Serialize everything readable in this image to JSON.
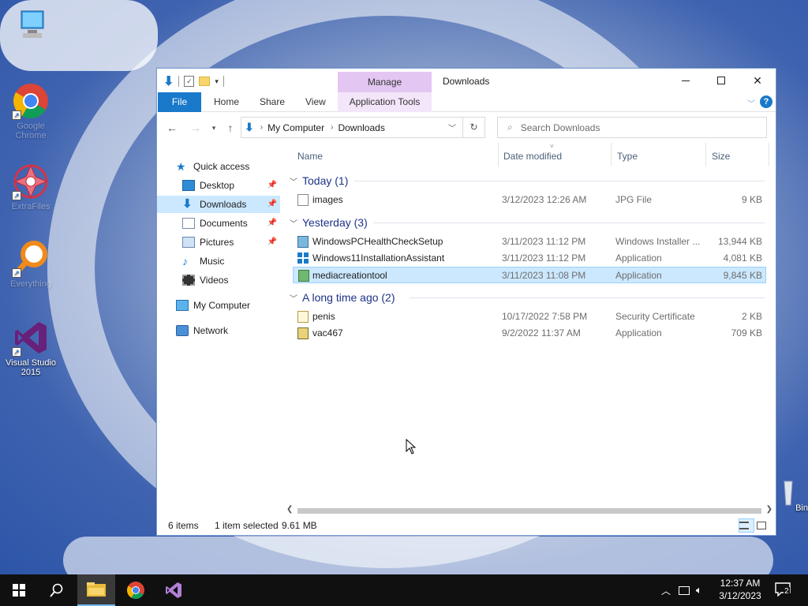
{
  "desktop": {
    "icons": [
      {
        "label": "",
        "icon": "computer-icon"
      },
      {
        "label": "Google Chrome",
        "icon": "chrome-icon"
      },
      {
        "label": "ExtraFiles",
        "icon": "mandala-icon"
      },
      {
        "label": "Everything",
        "icon": "magnifier-icon"
      },
      {
        "label": "Visual Studio 2015",
        "icon": "visual-studio-icon"
      },
      {
        "label": "Bin",
        "icon": "recycle-bin-icon"
      }
    ]
  },
  "explorer": {
    "title": "Downloads",
    "manage_tab": "Manage",
    "ribbon_tabs": [
      "File",
      "Home",
      "Share",
      "View",
      "Application Tools"
    ],
    "address": {
      "crumbs": [
        "My Computer",
        "Downloads"
      ]
    },
    "search_placeholder": "Search Downloads",
    "sidebar": [
      {
        "label": "Quick access",
        "icon": "star-icon"
      },
      {
        "label": "Desktop",
        "icon": "desktop-folder-icon",
        "pinned": true
      },
      {
        "label": "Downloads",
        "icon": "download-arrow-icon",
        "pinned": true,
        "selected": true
      },
      {
        "label": "Documents",
        "icon": "documents-icon",
        "pinned": true
      },
      {
        "label": "Pictures",
        "icon": "pictures-icon",
        "pinned": true
      },
      {
        "label": "Music",
        "icon": "music-note-icon"
      },
      {
        "label": "Videos",
        "icon": "film-icon"
      },
      {
        "label": "My Computer",
        "icon": "computer-icon"
      },
      {
        "label": "Network",
        "icon": "network-icon"
      }
    ],
    "columns": [
      "Name",
      "Date modified",
      "Type",
      "Size"
    ],
    "groups": [
      {
        "title": "Today (1)",
        "files": [
          {
            "name": "images",
            "date": "3/12/2023 12:26 AM",
            "type": "JPG File",
            "size": "9 KB",
            "icon": "image-file-icon"
          }
        ]
      },
      {
        "title": "Yesterday (3)",
        "files": [
          {
            "name": "WindowsPCHealthCheckSetup",
            "date": "3/11/2023 11:12 PM",
            "type": "Windows Installer ...",
            "size": "13,944 KB",
            "icon": "installer-icon"
          },
          {
            "name": "Windows11InstallationAssistant",
            "date": "3/11/2023 11:12 PM",
            "type": "Application",
            "size": "4,081 KB",
            "icon": "windows-logo-icon"
          },
          {
            "name": "mediacreationtool",
            "date": "3/11/2023 11:08 PM",
            "type": "Application",
            "size": "9,845 KB",
            "icon": "media-tool-icon",
            "selected": true
          }
        ]
      },
      {
        "title": "A long time ago (2)",
        "files": [
          {
            "name": "penis",
            "date": "10/17/2022 7:58 PM",
            "type": "Security Certificate",
            "size": "2 KB",
            "icon": "certificate-icon"
          },
          {
            "name": "vac467",
            "date": "9/2/2022 11:37 AM",
            "type": "Application",
            "size": "709 KB",
            "icon": "application-icon"
          }
        ]
      }
    ],
    "status": {
      "items": "6 items",
      "selected": "1 item selected",
      "size": "9.61 MB"
    }
  },
  "taskbar": {
    "time": "12:37 AM",
    "date": "3/12/2023",
    "notifications": "2"
  }
}
